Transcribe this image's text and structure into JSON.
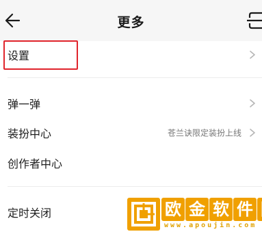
{
  "header": {
    "title": "更多"
  },
  "rows": [
    {
      "label": "设置"
    },
    {
      "label": "弹一弹"
    },
    {
      "label": "装扮中心",
      "value": "苍兰诀限定装扮上线"
    },
    {
      "label": "创作者中心"
    },
    {
      "label": "定时关闭"
    }
  ],
  "watermark": {
    "chars": [
      "欧",
      "金",
      "软",
      "件",
      "园"
    ],
    "url": "www.apoujin.com"
  },
  "colors": {
    "highlight": "#e0232b",
    "watermark": "#f0a000"
  }
}
